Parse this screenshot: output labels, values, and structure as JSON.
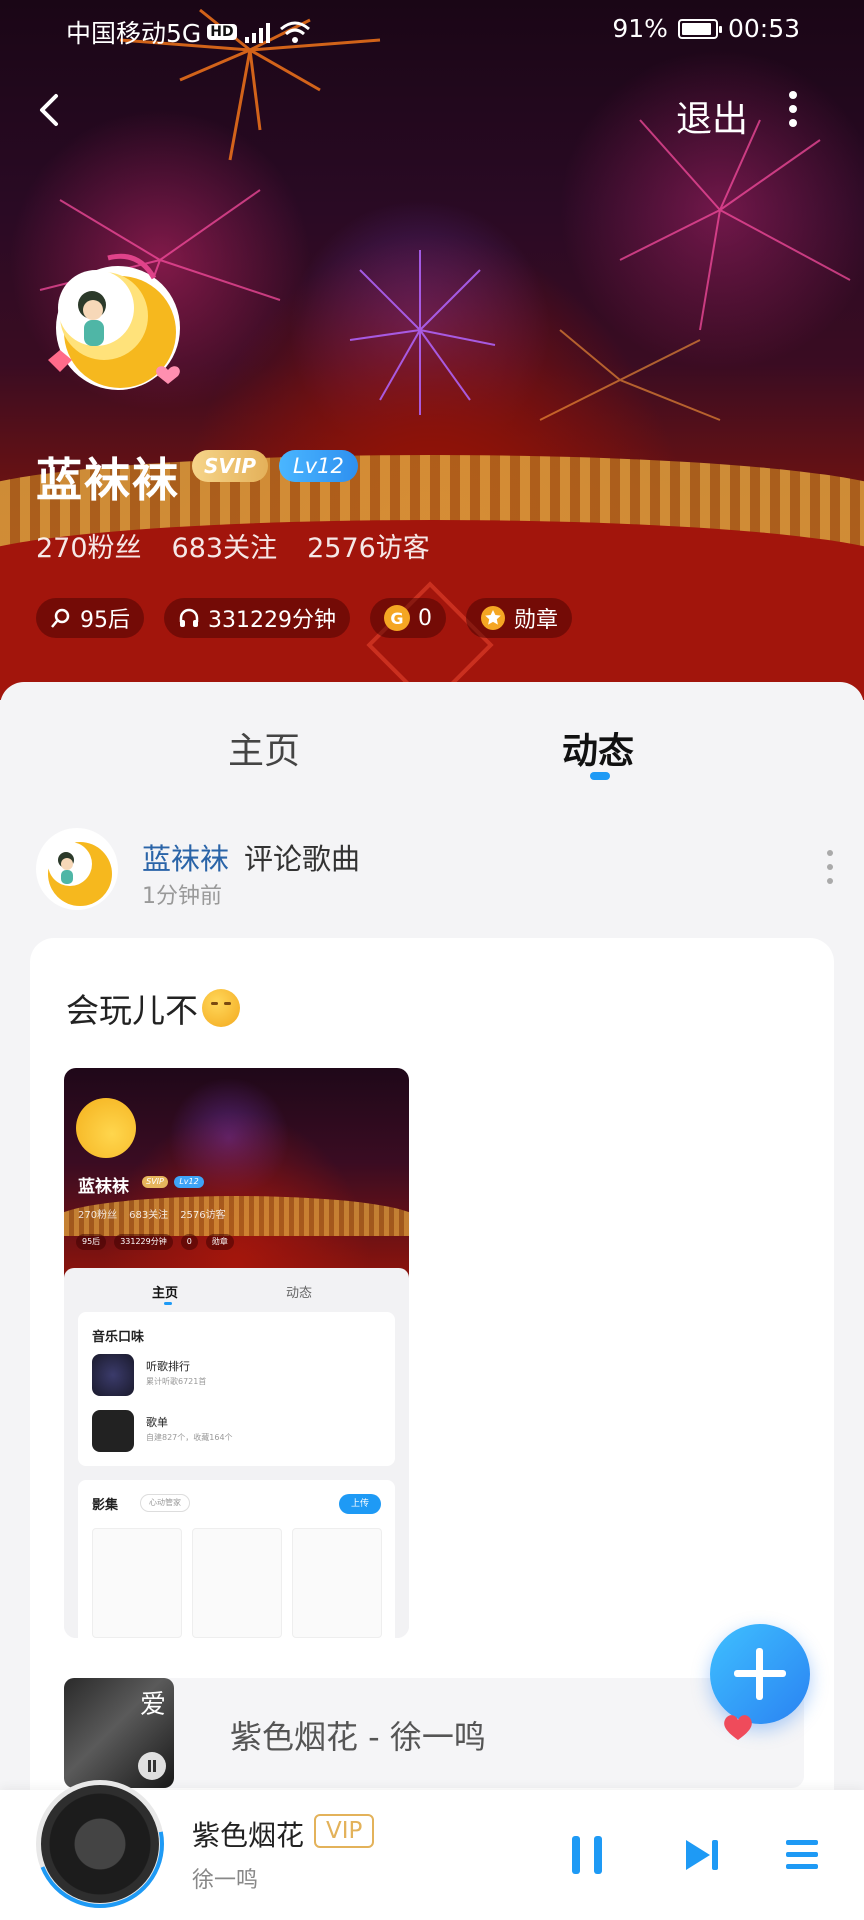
{
  "status_bar": {
    "carrier": "中国移动5G",
    "hd": "HD",
    "battery": "91%",
    "battery_level": 0.91,
    "time": "00:53"
  },
  "header": {
    "logout_label": "退出"
  },
  "profile": {
    "name": "蓝袜袜",
    "svip": "SVIP",
    "level": "Lv12",
    "fans": "270粉丝",
    "following": "683关注",
    "visitors": "2576访客",
    "chips": {
      "age": "95后",
      "listen_minutes": "331229分钟",
      "coins": "0",
      "medal": "勋章"
    }
  },
  "tabs": [
    {
      "label": "主页",
      "active": false
    },
    {
      "label": "动态",
      "active": true
    }
  ],
  "post": {
    "user": "蓝袜袜",
    "action": "评论歌曲",
    "time": "1分钟前",
    "text": "会玩儿不",
    "thumbnail": {
      "name": "蓝袜袜",
      "svip": "SVIP",
      "level": "Lv12",
      "stats": [
        "270粉丝",
        "683关注",
        "2576访客"
      ],
      "chips": [
        "95后",
        "331229分钟",
        "0",
        "勋章"
      ],
      "tabs": [
        "主页",
        "动态"
      ],
      "music_taste": {
        "title": "音乐口味",
        "items": [
          {
            "title": "听歌排行",
            "sub": "累计听歌6721首"
          },
          {
            "title": "歌单",
            "sub": "自建827个，收藏164个"
          }
        ]
      },
      "album": {
        "title": "影集",
        "fav": "心动管家",
        "upload": "上传"
      }
    },
    "song": "紫色烟花 - 徐一鸣"
  },
  "player": {
    "title": "紫色烟花",
    "vip": "VIP",
    "artist": "徐一鸣"
  },
  "colors": {
    "accent": "#1e9af5",
    "username": "#2a64a8",
    "vip_gold": "#e3b25a"
  }
}
